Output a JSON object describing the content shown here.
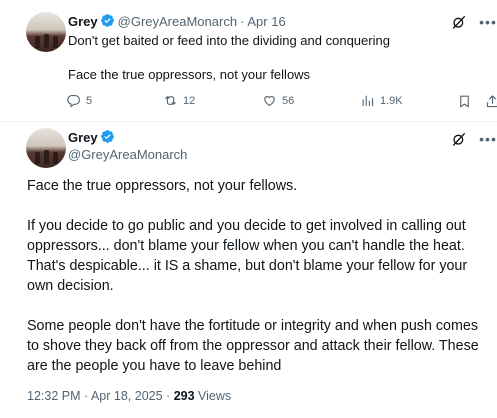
{
  "tweet1": {
    "name": "Grey",
    "handle": "@GreyAreaMonarch",
    "separator": "·",
    "date": "Apr 16",
    "lines": [
      "Don't get baited or feed into the dividing and conquering",
      "Face the true oppressors, not your fellows"
    ],
    "actions": {
      "replies": "5",
      "reposts": "12",
      "likes": "56",
      "views": "1.9K"
    }
  },
  "tweet2": {
    "name": "Grey",
    "handle": "@GreyAreaMonarch",
    "body_lines": [
      "Face the true oppressors, not your fellows.",
      "If you decide to go public and you decide to get involved in calling out",
      "oppressors... don't blame your fellow when you can't handle the heat.",
      "That's despicable... it IS a shame, but don't blame your fellow for your",
      "own decision.",
      "Some people don't have the fortitude or integrity and when push comes",
      "to shove they back off from the oppressor and attack their fellow. These",
      "are the people you have to leave behind"
    ],
    "time": "12:32 PM",
    "separator": "·",
    "date": "Apr 18, 2025",
    "separator2": "·",
    "views_count": "293",
    "views_label": "Views"
  },
  "colors": {
    "verified_badge": "#1d9bf0",
    "secondary_text": "#536471",
    "primary_text": "#0f1419"
  },
  "icons": [
    "verified-badge-icon",
    "grok-icon",
    "more-icon",
    "reply-icon",
    "repost-icon",
    "like-icon",
    "views-icon",
    "bookmark-icon",
    "share-icon"
  ]
}
